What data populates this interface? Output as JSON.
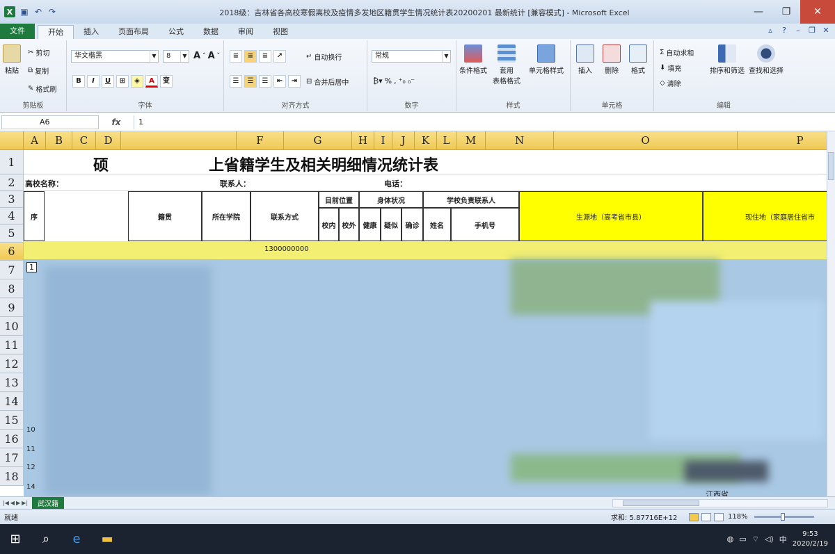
{
  "window": {
    "title": "2018级：吉林省各高校寒假离校及疫情多发地区籍贯学生情况统计表20200201 最新统计 [兼容模式] - Microsoft Excel",
    "app_icon": "X"
  },
  "ribbon_tabs": [
    "文件",
    "开始",
    "插入",
    "页面布局",
    "公式",
    "数据",
    "审阅",
    "视图"
  ],
  "clipboard": {
    "paste": "粘贴",
    "cut": "剪切",
    "copy": "复制",
    "format_painter": "格式刷",
    "label": "剪贴板"
  },
  "font": {
    "name": "华文楷黑",
    "size": "8",
    "label": "字体",
    "bold": "B",
    "italic": "I",
    "underline": "U",
    "phonetic": "变"
  },
  "alignment": {
    "wrap": "自动换行",
    "merge": "合并后居中",
    "label": "对齐方式"
  },
  "number": {
    "format": "常规",
    "percent": "%",
    "comma": ",",
    "label": "数字"
  },
  "styles": {
    "conditional": "条件格式",
    "table": "套用\n表格格式",
    "cell": "单元格样式",
    "label": "样式"
  },
  "cells": {
    "insert": "插入",
    "delete": "删除",
    "format": "格式",
    "label": "单元格"
  },
  "editing": {
    "autosum": "自动求和",
    "fill": "填充",
    "clear": "清除",
    "sort": "排序和筛选",
    "find": "查找和选择",
    "label": "编辑"
  },
  "formula_bar": {
    "name_box": "A6",
    "fx": "fx",
    "value": "1"
  },
  "columns": [
    "A",
    "B",
    "C",
    "D",
    "",
    "F",
    "G",
    "H",
    "I",
    "J",
    "K",
    "L",
    "M",
    "N",
    "O",
    "P"
  ],
  "rows": [
    "1",
    "2",
    "3",
    "4",
    "5",
    "6",
    "7",
    "8",
    "9",
    "10",
    "11",
    "12",
    "13",
    "14",
    "15",
    "16",
    "17",
    "18"
  ],
  "sheet": {
    "title_left": "硕",
    "title_right": "上省籍学生及相关明细情况统计表",
    "school_label": "高校名称：",
    "contact_label": "联系人：",
    "phone_label": "电话：",
    "headers": {
      "seq": "序",
      "hometown": "籍贯",
      "college": "所在学院",
      "contact": "联系方式",
      "location": "目前位置",
      "in_school": "校内",
      "out_school": "校外",
      "health": "身体状况",
      "healthy": "健康",
      "suspected": "疑似",
      "confirmed": "确诊",
      "school_contact": "学校负责联系人",
      "name": "姓名",
      "mobile": "手机号",
      "origin": "生源地（高考省市县）",
      "residence": "现住地（家庭居住省市"
    },
    "row5_contact": "1300000000",
    "row6_first": "1",
    "row_fragments": [
      "10",
      "11",
      "12",
      "14"
    ],
    "bottom_fragment": "江西省"
  },
  "sheet_tab": "武汉籍",
  "status": {
    "ready": "就绪",
    "sum": "求和: 5.87716E+12",
    "zoom": "118%"
  },
  "taskbar": {
    "time": "9:53",
    "date": "2020/2/19",
    "ime": "中"
  }
}
